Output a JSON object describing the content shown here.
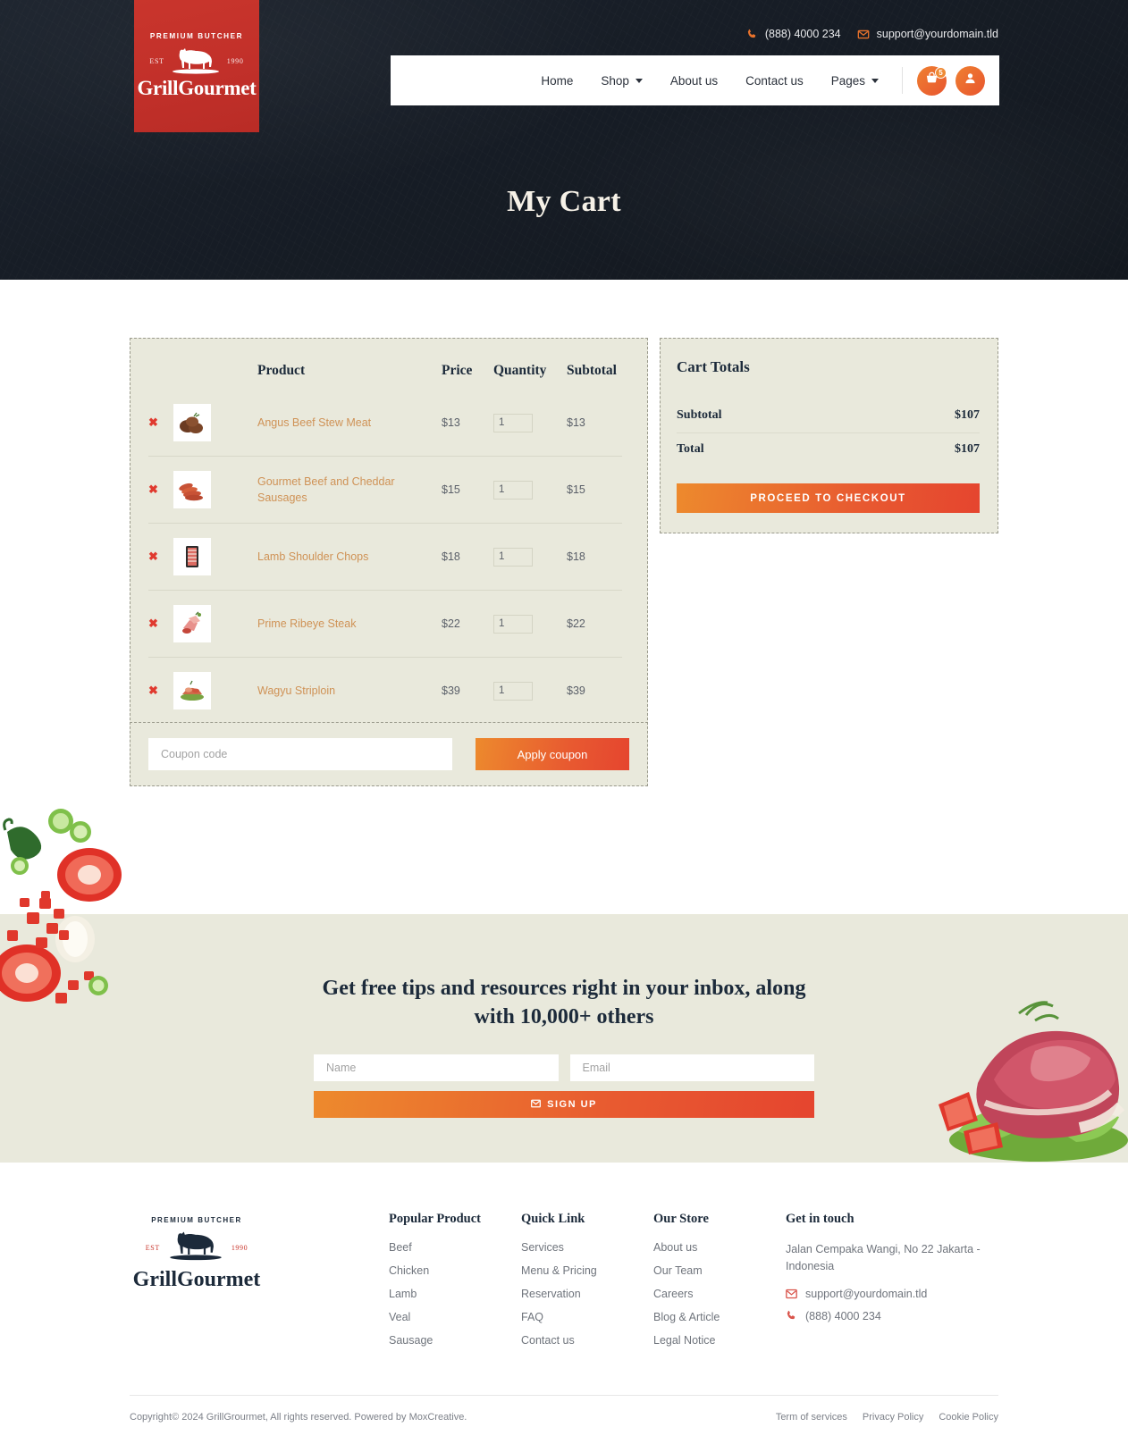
{
  "header": {
    "logo": {
      "premium": "PREMIUM BUTCHER",
      "est": "EST",
      "year": "1990",
      "name": "GrillGourmet"
    },
    "phone": "(888) 4000 234",
    "email": "support@yourdomain.tld",
    "nav": [
      {
        "label": "Home",
        "dropdown": false
      },
      {
        "label": "Shop",
        "dropdown": true
      },
      {
        "label": "About us",
        "dropdown": false
      },
      {
        "label": "Contact us",
        "dropdown": false
      },
      {
        "label": "Pages",
        "dropdown": true
      }
    ],
    "cart_count": "5"
  },
  "hero": {
    "title": "My Cart"
  },
  "cart": {
    "columns": {
      "product": "Product",
      "price": "Price",
      "quantity": "Quantity",
      "subtotal": "Subtotal"
    },
    "items": [
      {
        "name": "Angus Beef Stew Meat",
        "price": "$13",
        "qty": "1",
        "subtotal": "$13"
      },
      {
        "name": "Gourmet Beef and Cheddar Sausages",
        "price": "$15",
        "qty": "1",
        "subtotal": "$15"
      },
      {
        "name": "Lamb Shoulder Chops",
        "price": "$18",
        "qty": "1",
        "subtotal": "$18"
      },
      {
        "name": "Prime Ribeye Steak",
        "price": "$22",
        "qty": "1",
        "subtotal": "$22"
      },
      {
        "name": "Wagyu Striploin",
        "price": "$39",
        "qty": "1",
        "subtotal": "$39"
      }
    ],
    "coupon": {
      "placeholder": "Coupon code",
      "value": "",
      "button": "Apply coupon"
    }
  },
  "totals": {
    "title": "Cart Totals",
    "subtotal_label": "Subtotal",
    "subtotal_value": "$107",
    "total_label": "Total",
    "total_value": "$107",
    "checkout_button": "PROCEED TO CHECKOUT"
  },
  "newsletter": {
    "title": "Get free tips and resources right in your inbox, along with 10,000+ others",
    "name_placeholder": "Name",
    "email_placeholder": "Email",
    "button": "SIGN UP"
  },
  "footer": {
    "logo": {
      "premium": "PREMIUM BUTCHER",
      "est": "EST",
      "year": "1990",
      "name": "GrillGourmet"
    },
    "columns": [
      {
        "title": "Popular Product",
        "links": [
          "Beef",
          "Chicken",
          "Lamb",
          "Veal",
          "Sausage"
        ]
      },
      {
        "title": "Quick Link",
        "links": [
          "Services",
          "Menu & Pricing",
          "Reservation",
          "FAQ",
          "Contact us"
        ]
      },
      {
        "title": "Our Store",
        "links": [
          "About us",
          "Our Team",
          "Careers",
          "Blog & Article",
          "Legal Notice"
        ]
      }
    ],
    "contact": {
      "title": "Get in touch",
      "address": "Jalan Cempaka Wangi, No 22 Jakarta - Indonesia",
      "email": "support@yourdomain.tld",
      "phone": "(888) 4000 234"
    },
    "copyright": "Copyright© 2024 GrillGrourmet, All rights reserved. Powered by MoxCreative.",
    "legal": [
      "Term of services",
      "Privacy Policy",
      "Cookie Policy"
    ]
  },
  "colors": {
    "accent_orange": "#e8722c",
    "accent_red": "#e5452f",
    "brand_red": "#c9352c",
    "dark": "#1c2a3a",
    "beige": "#e9e9dc"
  }
}
